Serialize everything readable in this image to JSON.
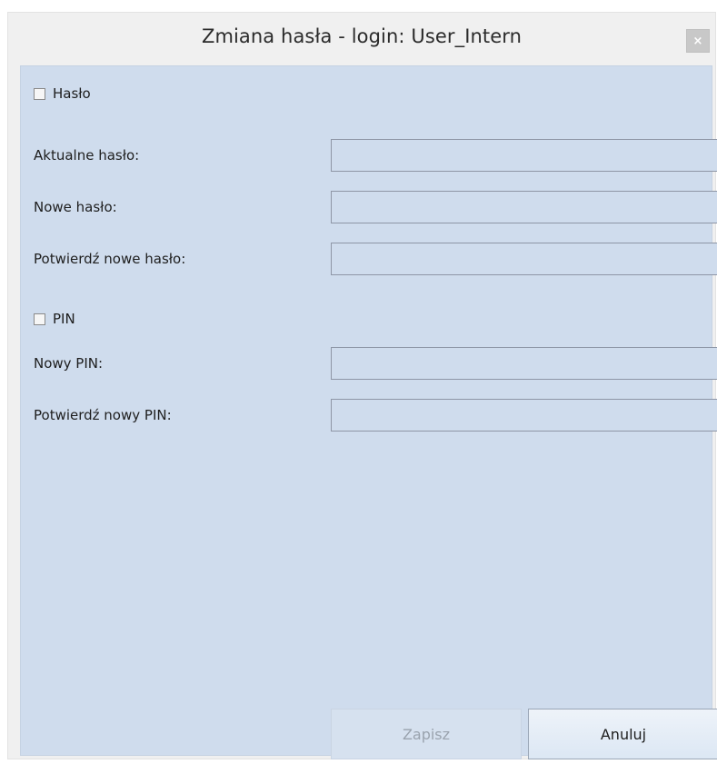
{
  "window": {
    "title": "Zmiana hasła - login: User_Intern",
    "close_glyph": "×"
  },
  "password_section": {
    "checkbox_label": "Hasło",
    "checked": false,
    "current_password_label": "Aktualne hasło:",
    "current_password_value": "",
    "new_password_label": "Nowe hasło:",
    "new_password_value": "",
    "confirm_password_label": "Potwierdź nowe hasło:",
    "confirm_password_value": ""
  },
  "pin_section": {
    "checkbox_label": "PIN",
    "checked": false,
    "new_pin_label": "Nowy PIN:",
    "new_pin_value": "",
    "confirm_pin_label": "Potwierdź nowy PIN:",
    "confirm_pin_value": ""
  },
  "buttons": {
    "save_label": "Zapisz",
    "save_enabled": false,
    "cancel_label": "Anuluj"
  },
  "colors": {
    "panel_background": "#cfdced",
    "window_background": "#f0f0f0",
    "close_button": "#c8c8c8",
    "disabled_text": "#9aa3ae"
  },
  "icons": {
    "close": "close-icon"
  }
}
